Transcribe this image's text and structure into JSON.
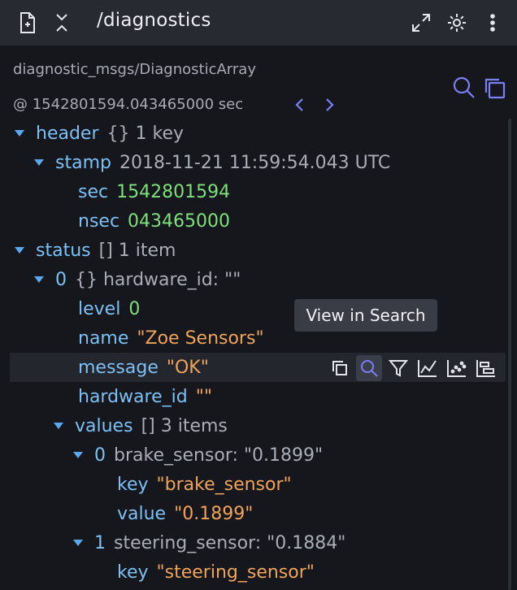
{
  "panel": {
    "title": "/diagnostics",
    "schema": "diagnostic_msgs/DiagnosticArray",
    "timestamp": "@ 1542801594.043465000 sec"
  },
  "tooltip": "View in Search",
  "tree": {
    "header_key": "header",
    "header_meta": "{} 1 key",
    "stamp_key": "stamp",
    "stamp_meta": "2018-11-21 11:59:54.043 UTC",
    "sec_key": "sec",
    "sec_val": "1542801594",
    "nsec_key": "nsec",
    "nsec_val": "043465000",
    "status_key": "status",
    "status_meta": "[] 1 item",
    "status0_idx": "0",
    "status0_meta": "{} hardware_id: \"\"",
    "level_key": "level",
    "level_val": "0",
    "name_key": "name",
    "name_val": "\"Zoe Sensors\"",
    "message_key": "message",
    "message_val": "\"OK\"",
    "hwid_key": "hardware_id",
    "hwid_val": "\"\"",
    "values_key": "values",
    "values_meta": "[] 3 items",
    "v0_idx": "0",
    "v0_meta": "brake_sensor: \"0.1899\"",
    "v0_key_key": "key",
    "v0_key_val": "\"brake_sensor\"",
    "v0_value_key": "value",
    "v0_value_val": "\"0.1899\"",
    "v1_idx": "1",
    "v1_meta": "steering_sensor: \"0.1884\"",
    "v1_key_key": "key",
    "v1_key_val": "\"steering_sensor\""
  },
  "icons": {
    "file": "file-settings-icon",
    "collapse": "collapse-icon",
    "expand": "fullscreen-icon",
    "settings": "gear-icon",
    "more": "more-vertical-icon",
    "search": "search-icon",
    "copy": "copy-icon",
    "prev": "chevron-left-icon",
    "next": "chevron-right-icon",
    "filter": "filter-icon",
    "line_chart": "line-chart-icon",
    "scatter": "scatter-plot-icon",
    "state_transitions": "state-transitions-icon"
  },
  "colors": {
    "background": "#15171d",
    "titlebar": "#272a31",
    "key": "#7cc0f5",
    "number": "#7ee07a",
    "string": "#f0a45a",
    "accent": "#7b7ff5"
  }
}
